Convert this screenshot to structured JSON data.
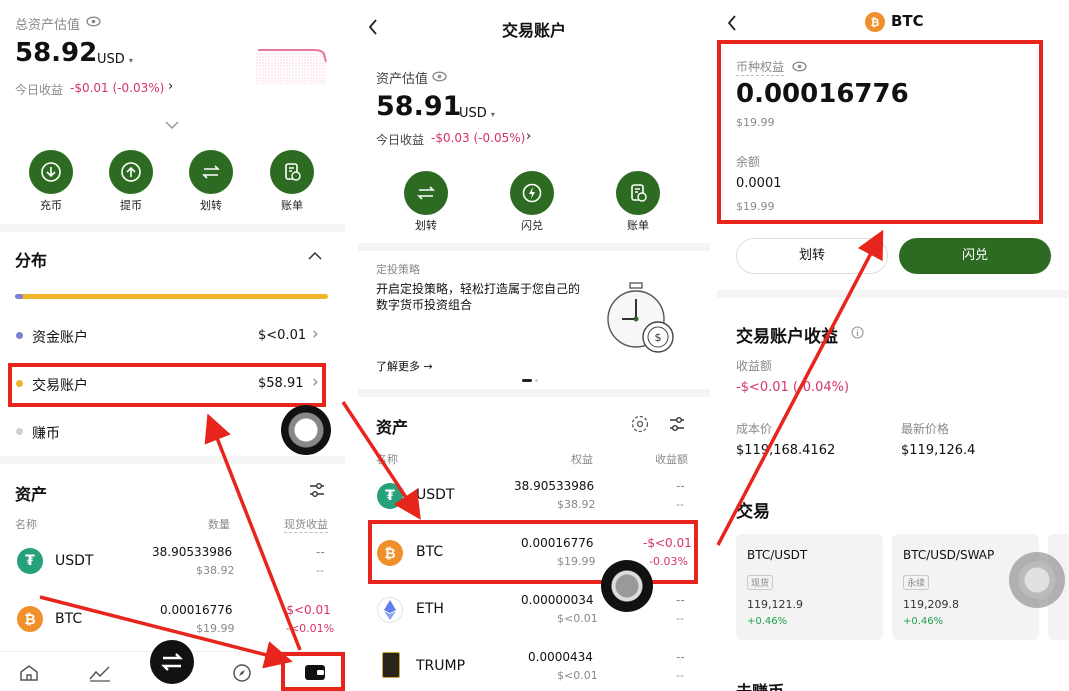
{
  "p1": {
    "total_label": "总资产估值",
    "total_value": "58.92",
    "total_unit": "USD",
    "today_label": "今日收益",
    "today_value": "-$0.01 (-0.03%)",
    "actions": [
      {
        "label": "充币",
        "icon": "download-icon"
      },
      {
        "label": "提币",
        "icon": "upload-icon"
      },
      {
        "label": "划转",
        "icon": "transfer-icon"
      },
      {
        "label": "账单",
        "icon": "bill-icon"
      }
    ],
    "dist_title": "分布",
    "accounts": [
      {
        "name": "资金账户",
        "value": "$<0.01",
        "color": "#7b7fd6"
      },
      {
        "name": "交易账户",
        "value": "$58.91",
        "color": "#f0b429"
      },
      {
        "name": "赚币",
        "value": "",
        "color": "#d0d0d0"
      }
    ],
    "assets_title": "资产",
    "col_name": "名称",
    "col_qty": "数量",
    "col_pnl": "现货收益",
    "assets": [
      {
        "symbol": "USDT",
        "qty": "38.90533986",
        "usd": "$38.92",
        "pnl1": "--",
        "pnl2": "--"
      },
      {
        "symbol": "BTC",
        "qty": "0.00016776",
        "usd": "$19.99",
        "pnl1": "-$<0.01",
        "pnl2": "-<0.01%"
      }
    ]
  },
  "p2": {
    "title": "交易账户",
    "est_label": "资产估值",
    "est_value": "58.91",
    "est_unit": "USD",
    "today_label": "今日收益",
    "today_value": "-$0.03 (-0.05%)",
    "actions": [
      {
        "label": "划转",
        "icon": "transfer-icon"
      },
      {
        "label": "闪兑",
        "icon": "flash-icon"
      },
      {
        "label": "账单",
        "icon": "bill-icon"
      }
    ],
    "promo_tag": "定投策略",
    "promo_text": "开启定投策略，轻松打造属于您自己的数字货币投资组合",
    "promo_link": "了解更多",
    "assets_title": "资产",
    "col_name": "名称",
    "col_equity": "权益",
    "col_pnl": "收益额",
    "assets": [
      {
        "symbol": "USDT",
        "qty": "38.90533986",
        "usd": "$38.92",
        "pnl1": "--",
        "pnl2": "--"
      },
      {
        "symbol": "BTC",
        "qty": "0.00016776",
        "usd": "$19.99",
        "pnl1": "-$<0.01",
        "pnl2": "-0.03%"
      },
      {
        "symbol": "ETH",
        "qty": "0.00000034",
        "usd": "$<0.01",
        "pnl1": "--",
        "pnl2": "--"
      },
      {
        "symbol": "TRUMP",
        "qty": "0.0000434",
        "usd": "$<0.01",
        "pnl1": "--",
        "pnl2": "--"
      }
    ]
  },
  "p3": {
    "title": "BTC",
    "equity_label": "币种权益",
    "equity_value": "0.00016776",
    "equity_usd": "$19.99",
    "balance_label": "余额",
    "balance_value": "0.0001",
    "balance_usd": "$19.99",
    "btn_transfer": "划转",
    "btn_flash": "闪兑",
    "pnl_title": "交易账户收益",
    "pnl_label": "收益额",
    "pnl_value": "-$<0.01 (-0.04%)",
    "cost_label": "成本价",
    "cost_value": "$119,168.4162",
    "last_label": "最新价格",
    "last_value": "$119,126.4",
    "trade_title": "交易",
    "pairs": [
      {
        "name": "BTC/USDT",
        "tag": "现货",
        "price": "119,121.9",
        "change": "+0.46%"
      },
      {
        "name": "BTC/USD/SWAP",
        "tag": "永续",
        "price": "119,209.8",
        "change": "+0.46%"
      }
    ],
    "earn_title": "去赚币"
  }
}
